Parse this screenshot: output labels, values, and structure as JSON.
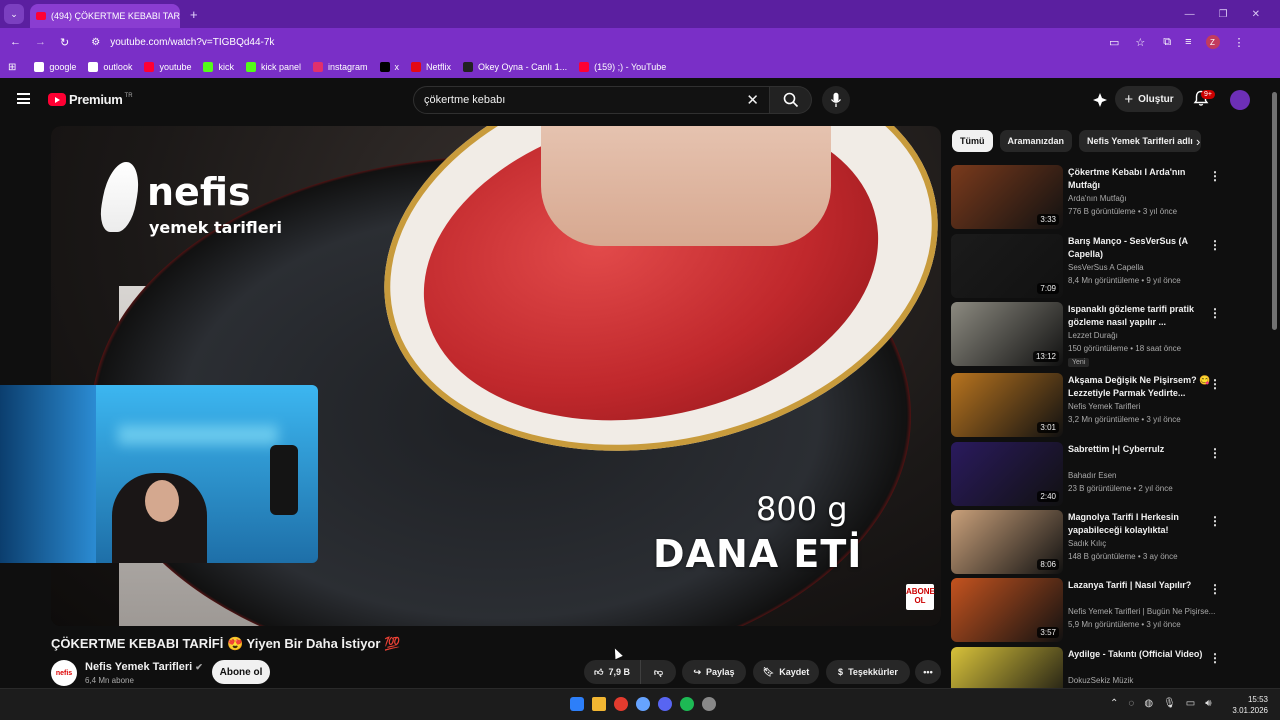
{
  "browser": {
    "tab": {
      "title": "(494) ÇÖKERTME KEBABI TARİFİ",
      "close": "✕"
    },
    "new_tab": "+",
    "url": "youtube.com/watch?v=TIGBQd44-7k",
    "profile_initial": "Z",
    "bookmarks": [
      {
        "label": "google",
        "color": "#ffffff"
      },
      {
        "label": "outlook",
        "color": "#ffffff"
      },
      {
        "label": "youtube",
        "color": "#ff0033"
      },
      {
        "label": "kick",
        "color": "#53fc18"
      },
      {
        "label": "kick panel",
        "color": "#53fc18"
      },
      {
        "label": "instagram",
        "color": "#e1306c"
      },
      {
        "label": "x",
        "color": "#000000"
      },
      {
        "label": "Netflix",
        "color": "#e50914"
      },
      {
        "label": "Okey Oyna - Canlı 1...",
        "color": "#222222"
      },
      {
        "label": "(159) ;) - YouTube",
        "color": "#ff0033"
      }
    ]
  },
  "youtube": {
    "logo_text": "Premium",
    "logo_region": "TR",
    "search_value": "çökertme kebabı",
    "create_label": "Oluştur",
    "notif_count": "9+",
    "video": {
      "overlay_brand_1": "nefis",
      "overlay_brand_2": "yemek tarifleri",
      "overlay_amount": "800 g",
      "overlay_item": "DANA ETİ",
      "abone_badge": "ABONE OL",
      "title": "ÇÖKERTME KEBABI TARİFİ 😍 Yiyen Bir Daha İstiyor 💯",
      "channel": "Nefis Yemek Tarifleri",
      "channel_avatar": "nefis",
      "subs": "6,4 Mn abone",
      "subscribe": "Abone ol",
      "likes": "7,9 B",
      "share": "Paylaş",
      "save": "Kaydet",
      "thanks": "Teşekkürler",
      "more": "•••"
    },
    "chips": [
      "Tümü",
      "Aramanızdan",
      "Nefis Yemek Tarifleri adlı"
    ],
    "recommendations": [
      {
        "title": "Çökertme Kebabı I Arda'nın Mutfağı",
        "channel": "Arda'nın Mutfağı",
        "meta": "776 B görüntüleme • 3 yıl önce",
        "duration": "3:33",
        "thumb": "#7a3a1c"
      },
      {
        "title": "Barış Manço - SesVerSus (A Capella)",
        "channel": "SesVerSus A Capella",
        "meta": "8,4 Mn görüntüleme • 9 yıl önce",
        "duration": "7:09",
        "thumb": "#1b1b1b"
      },
      {
        "title": "Ispanaklı gözleme tarifi pratik gözleme nasıl yapılır ...",
        "channel": "Lezzet Durağı",
        "meta": "150 görüntüleme • 18 saat önce",
        "duration": "13:12",
        "thumb": "#8c8a80",
        "badge": "Yeni"
      },
      {
        "title": "Akşama Değişik Ne Pişirsem? 😋 Lezzetiyle Parmak Yedirte...",
        "channel": "Nefis Yemek Tarifleri",
        "meta": "3,2 Mn görüntüleme • 3 yıl önce",
        "duration": "3:01",
        "thumb": "#b8741f"
      },
      {
        "title": "Sabrettim |•| Cyberrulz",
        "channel": "Bahadır Esen",
        "meta": "23 B görüntüleme • 2 yıl önce",
        "duration": "2:40",
        "thumb": "#2a1a5e"
      },
      {
        "title": "Magnolya Tarifi I Herkesin yapabileceği kolaylıkta!",
        "channel": "Sadık Kılıç",
        "meta": "148 B görüntüleme • 3 ay önce",
        "duration": "8:06",
        "thumb": "#c9a07a"
      },
      {
        "title": "Lazanya Tarifi | Nasıl Yapılır?",
        "channel": "Nefis Yemek Tarifleri | Bugün Ne Pişirse...",
        "meta": "5,9 Mn görüntüleme • 3 yıl önce",
        "duration": "3:57",
        "thumb": "#c4531f"
      },
      {
        "title": "Aydilge - Takıntı (Official Video)",
        "channel": "DokuzSekiz Müzik",
        "meta": "272 B görüntüleme • 4 yıl önce",
        "duration": "",
        "thumb": "#d8c23a"
      }
    ]
  },
  "taskbar": {
    "time": "15:53",
    "date": "3.01.2026",
    "apps": [
      "#2d7ff9",
      "#f2b632",
      "#e33b2e",
      "#66a3ff",
      "#5865f2",
      "#1db954",
      "#888888"
    ]
  },
  "colors": {
    "accent": "#7a2fc7",
    "yt_red": "#ff0033"
  }
}
